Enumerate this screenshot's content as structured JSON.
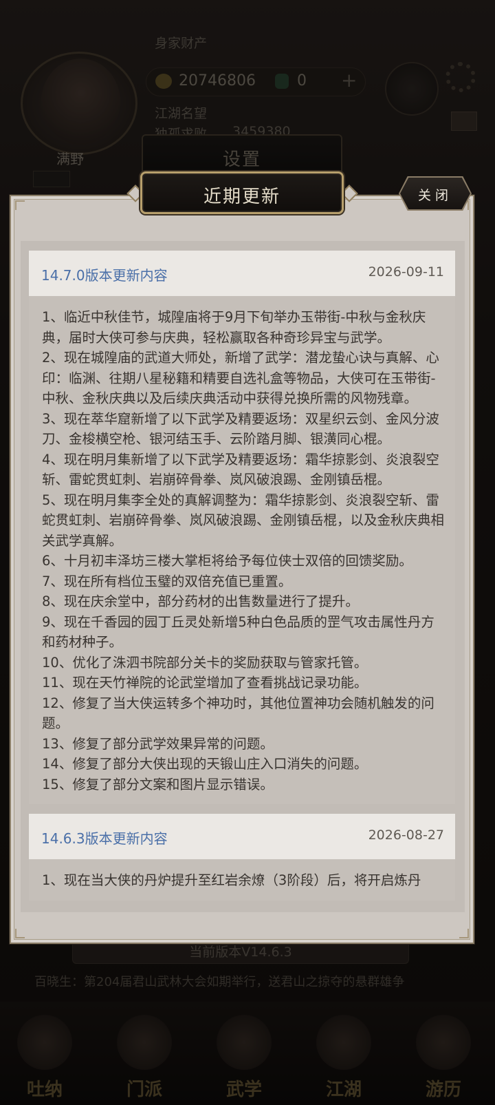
{
  "background": {
    "name": "满野",
    "label_assets": "身家财产",
    "coins": "20746806",
    "jade": "0",
    "label_reputation": "江湖名望",
    "label_rank": "独孤求败",
    "reputation_value": "3459380",
    "settings_tab": "设置",
    "version_text": "当前版本V14.6.3",
    "news_text": "百晓生：第204届君山武林大会如期举行，送君山之掠夺的悬群雄争",
    "nav": [
      "吐纳",
      "门派",
      "武学",
      "江湖",
      "游历"
    ]
  },
  "modal": {
    "title": "近期更新",
    "close_label": "关闭"
  },
  "releases": [
    {
      "title": "14.7.0版本更新内容",
      "date": "2026-09-11",
      "items": [
        "1、临近中秋佳节，城隍庙将于9月下旬举办玉带街-中秋与金秋庆典，届时大侠可参与庆典，轻松赢取各种奇珍异宝与武学。",
        "2、现在城隍庙的武道大师处，新增了武学：潜龙蛰心诀与真解、心印：临渊、往期八星秘籍和精要自选礼盒等物品，大侠可在玉带街-中秋、金秋庆典以及后续庆典活动中获得兑换所需的风物残章。",
        "3、现在萃华窟新增了以下武学及精要返场：双星织云剑、金风分波刀、金梭横空枪、银河结玉手、云阶踏月脚、银潢同心棍。",
        "4、现在明月集新增了以下武学及精要返场：霜华掠影剑、炎浪裂空斩、雷蛇贯虹刺、岩崩碎骨拳、岚风破浪踢、金刚镇岳棍。",
        "5、现在明月集李全处的真解调整为：霜华掠影剑、炎浪裂空斩、雷蛇贯虹刺、岩崩碎骨拳、岚风破浪踢、金刚镇岳棍，以及金秋庆典相关武学真解。",
        "6、十月初丰泽坊三楼大掌柜将给予每位侠士双倍的回馈奖励。",
        "7、现在所有档位玉璧的双倍充值已重置。",
        "8、现在庆余堂中，部分药材的出售数量进行了提升。",
        "9、现在千香园的园丁丘灵处新增5种白色品质的罡气攻击属性丹方和药材种子。",
        "10、优化了洙泗书院部分关卡的奖励获取与管家托管。",
        "11、现在天竹禅院的论武堂增加了查看挑战记录功能。",
        "12、修复了当大侠运转多个神功时，其他位置神功会随机触发的问题。",
        "13、修复了部分武学效果异常的问题。",
        "14、修复了部分大侠出现的天锻山庄入口消失的问题。",
        "15、修复了部分文案和图片显示错误。"
      ]
    },
    {
      "title": "14.6.3版本更新内容",
      "date": "2026-08-27",
      "items": [
        "1、现在当大侠的丹炉提升至红岩余燎（3阶段）后，将开启炼丹"
      ]
    }
  ]
}
